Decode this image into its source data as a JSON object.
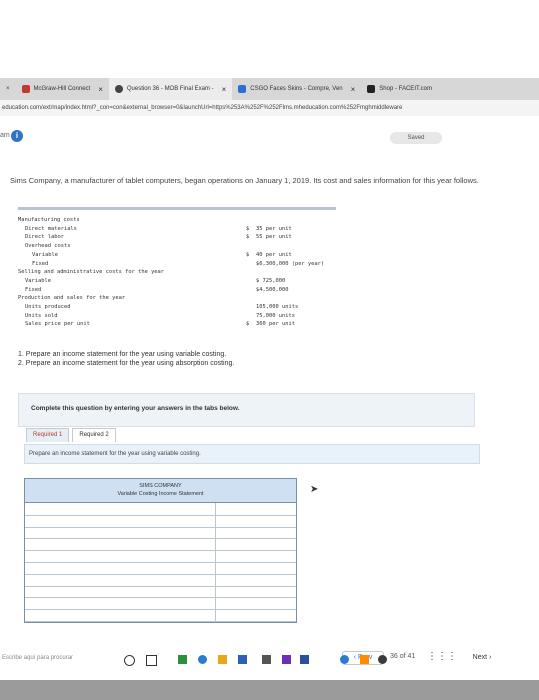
{
  "browser": {
    "tabs": [
      {
        "label": "McGraw-Hill Connect",
        "close": "×"
      },
      {
        "label": "Question 36 - MOB Final Exam - ",
        "close": "×"
      },
      {
        "label": "CSGO Faces Skins - Compre, Ven",
        "close": "×"
      },
      {
        "label": "Shop - FACEIT.com",
        "close": ""
      }
    ],
    "tab_close_left": "×",
    "url": "education.com/ext/map/index.html?_con=con&external_browser=0&launchUrl=https%253A%252F%252Flms.mheducation.com%252Fmghmiddleware"
  },
  "app": {
    "am_label": "am",
    "info_icon_glyph": "i",
    "saved_label": "Saved"
  },
  "problem": {
    "intro": "Sims Company, a manufacturer of tablet computers, began operations on January 1, 2019. Its cost and sales information for this year follows.",
    "rows": [
      {
        "label": "Manufacturing costs",
        "indent": 0,
        "dollar": "",
        "value": ""
      },
      {
        "label": "Direct materials",
        "indent": 1,
        "dollar": "$",
        "value": "35 per unit"
      },
      {
        "label": "Direct labor",
        "indent": 1,
        "dollar": "$",
        "value": "55 per unit"
      },
      {
        "label": "Overhead costs",
        "indent": 1,
        "dollar": "",
        "value": ""
      },
      {
        "label": "Variable",
        "indent": 2,
        "dollar": "$",
        "value": "40 per unit"
      },
      {
        "label": "Fixed",
        "indent": 2,
        "dollar": "",
        "value": "$6,300,000 (per year)"
      },
      {
        "label": "Selling and administrative costs for the year",
        "indent": 0,
        "dollar": "",
        "value": ""
      },
      {
        "label": "Variable",
        "indent": 1,
        "dollar": "",
        "value": "$ 725,000"
      },
      {
        "label": "Fixed",
        "indent": 1,
        "dollar": "",
        "value": "$4,500,000"
      },
      {
        "label": "Production and sales for the year",
        "indent": 0,
        "dollar": "",
        "value": ""
      },
      {
        "label": "Units produced",
        "indent": 1,
        "dollar": "",
        "value": "105,000 units"
      },
      {
        "label": "Units sold",
        "indent": 1,
        "dollar": "",
        "value": "75,000 units"
      },
      {
        "label": "Sales price per unit",
        "indent": 1,
        "dollar": "$",
        "value": "360 per unit"
      }
    ],
    "req1": "1. Prepare an income statement for the year using variable costing.",
    "req2": "2. Prepare an income statement for the year using absorption costing."
  },
  "answer": {
    "complete_prompt": "Complete this question by entering your answers in the tabs below.",
    "tab1_label": "Required 1",
    "tab2_label": "Required 2",
    "instruction": "Prepare an income statement for the year using variable costing.",
    "statement_company": "SIMS COMPANY",
    "statement_title": "Variable Costing Income Statement"
  },
  "nav": {
    "prev_label": "Prev",
    "page_current": "36",
    "page_of": "of",
    "page_total": "41",
    "next_label": "Next",
    "grid_icon_glyph": "⋮⋮⋮"
  },
  "taskbar": {
    "search_placeholder": "Escribe aquí para procurar"
  }
}
